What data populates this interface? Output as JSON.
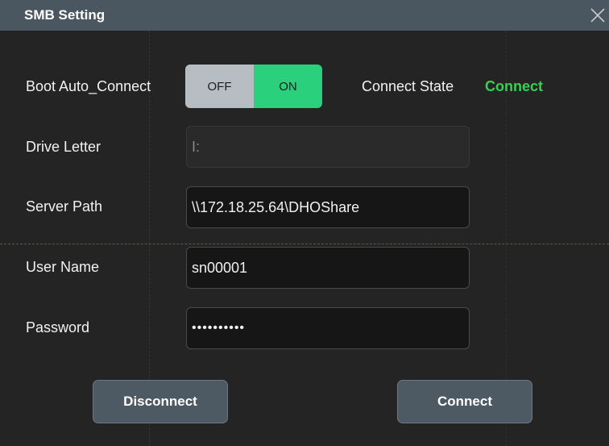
{
  "dialog": {
    "title": "SMB Setting",
    "close_icon": "close-icon"
  },
  "boot_auto_connect": {
    "label": "Boot Auto_Connect",
    "off_label": "OFF",
    "on_label": "ON",
    "value": "ON"
  },
  "connect_state": {
    "label": "Connect State",
    "value": "Connect",
    "value_color": "#35d054"
  },
  "drive_letter": {
    "label": "Drive Letter",
    "value": "I:",
    "enabled": false
  },
  "server_path": {
    "label": "Server Path",
    "value": "\\\\172.18.25.64\\DHOShare"
  },
  "user_name": {
    "label": "User Name",
    "value": "sn00001"
  },
  "password": {
    "label": "Password",
    "value": "••••••••••"
  },
  "buttons": {
    "disconnect_label": "Disconnect",
    "connect_label": "Connect"
  },
  "colors": {
    "titlebar": "#4a5761",
    "toggle_on": "#2bd07c",
    "toggle_off": "#b7bec3"
  }
}
